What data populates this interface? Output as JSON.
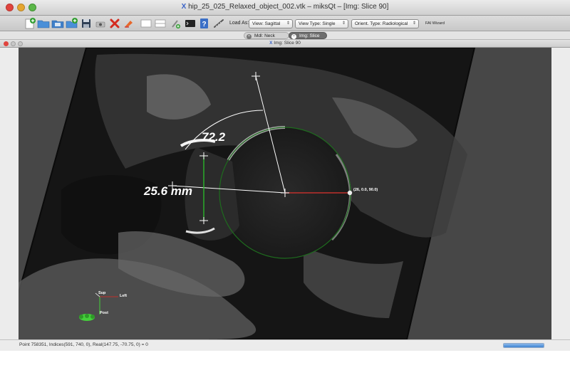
{
  "window": {
    "title": "hip_25_025_Relaxed_object_002.vtk – miksQt – [Img: Slice 90]",
    "title_icon": "x-logo-icon"
  },
  "toolbar": {
    "load_as_label": "Load As:",
    "view_select": "View: Sagittal",
    "view_type_select": "View Type: Single",
    "orient_select": "Orient. Type: Radiological",
    "fai_wizard_label": "FAI Wizard",
    "icons": [
      "new-icon",
      "open-folder-icon",
      "open-series-icon",
      "add-icon",
      "save-icon",
      "screenshot-icon",
      "delete-icon",
      "clear-icon",
      "layout-single-icon",
      "layout-split-icon",
      "pick-icon",
      "terminal-icon",
      "help-icon",
      "measure-icon"
    ]
  },
  "tabs": [
    {
      "label": "Mdl: Neck Axis",
      "active": false
    },
    {
      "label": "Img: Slice 90",
      "active": true
    }
  ],
  "subwindow": {
    "title": "Img: Slice 90"
  },
  "viewport": {
    "angle_label": "72.2",
    "distance_label": "25.6 mm",
    "point_coord_label": "(26, 0.0, 90.0)",
    "orientation": {
      "sup": "Sup",
      "left": "Left",
      "post": "Post"
    },
    "colors": {
      "neck_axis": "#c0302c",
      "circle": "#1e6b1e",
      "measure_line": "#ffffff",
      "orientation_marker": "#44d13a",
      "distance_line": "#2ac02a"
    }
  },
  "status": {
    "text": "Point 758351, Indices(591, 740, 0), Real(147.75, -70.75, 0) = 0",
    "progress": 1.0
  }
}
